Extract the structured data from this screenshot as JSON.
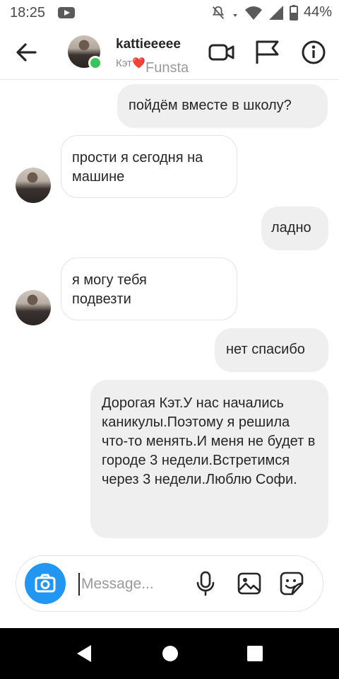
{
  "status_bar": {
    "time": "18:25",
    "battery": "44%"
  },
  "header": {
    "username": "kattieeeee",
    "subtitle": "Кэт",
    "heart": "❤️",
    "overlay": "Funsta"
  },
  "messages": [
    {
      "dir": "out",
      "text": "пойдём вместе в школу?"
    },
    {
      "dir": "in",
      "text": "прости я сегодня на машине"
    },
    {
      "dir": "out",
      "text": "ладно"
    },
    {
      "dir": "in",
      "text": "я могу тебя подвезти"
    },
    {
      "dir": "out",
      "text": "нет спасибо"
    },
    {
      "dir": "out",
      "text": "Дорогая Кэт.У нас начались каникулы.Поэтому я решила что-то менять.И меня не будет в городе 3 недели.Встретимся через 3 недели.Люблю Софи."
    }
  ],
  "composer": {
    "placeholder": "Message..."
  },
  "colors": {
    "accent": "#2196f3",
    "online": "#38c45b",
    "bubble_out": "#efefef"
  },
  "icons": [
    "back-arrow-icon",
    "video-camera-icon",
    "flag-icon",
    "info-icon",
    "camera-icon",
    "microphone-icon",
    "gallery-icon",
    "sticker-icon"
  ]
}
